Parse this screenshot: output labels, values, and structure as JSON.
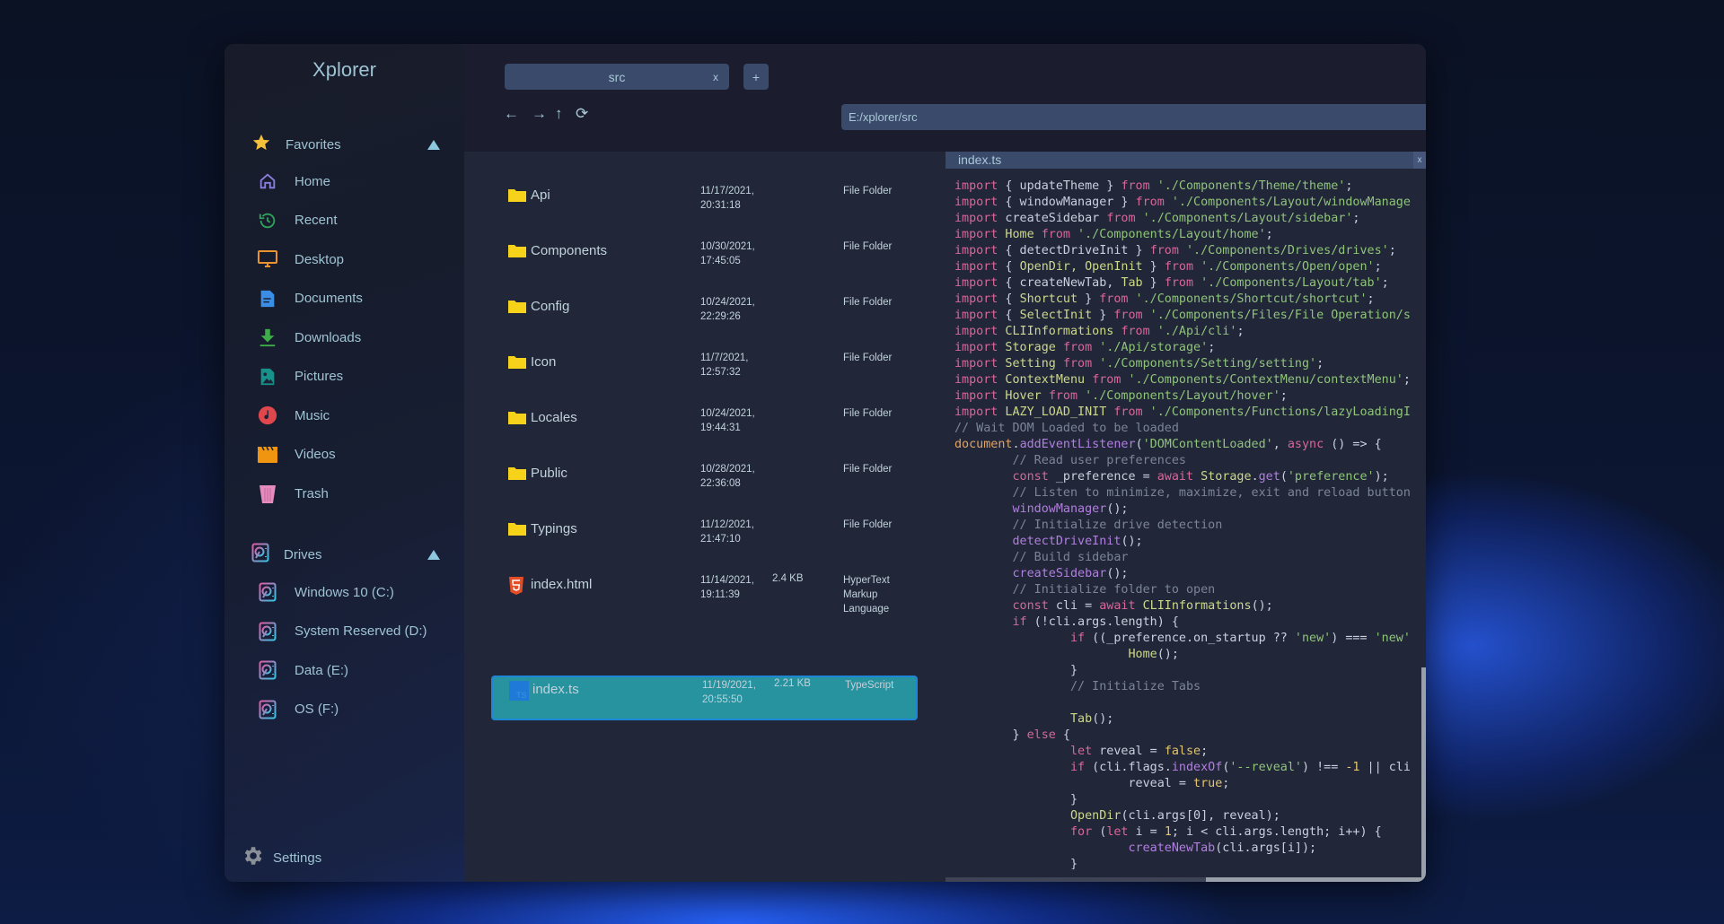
{
  "app": {
    "title": "Xplorer"
  },
  "colors": {
    "accent": "#27939f",
    "traffic": [
      "#ffd60a",
      "#1dbf45",
      "#ff453a"
    ]
  },
  "sidebar": {
    "favorites": {
      "label": "Favorites",
      "icon": "star-icon"
    },
    "items": [
      {
        "label": "Home",
        "icon": "home-icon"
      },
      {
        "label": "Recent",
        "icon": "recent-icon"
      },
      {
        "label": "Desktop",
        "icon": "desktop-icon"
      },
      {
        "label": "Documents",
        "icon": "document-icon"
      },
      {
        "label": "Downloads",
        "icon": "download-icon"
      },
      {
        "label": "Pictures",
        "icon": "picture-icon"
      },
      {
        "label": "Music",
        "icon": "music-icon"
      },
      {
        "label": "Videos",
        "icon": "video-icon"
      },
      {
        "label": "Trash",
        "icon": "trash-icon"
      }
    ],
    "drives_header": {
      "label": "Drives",
      "icon": "drive-icon"
    },
    "drives": [
      {
        "label": "Windows 10 (C:)"
      },
      {
        "label": "System Reserved (D:)"
      },
      {
        "label": "Data (E:)"
      },
      {
        "label": "OS (F:)"
      }
    ],
    "settings": {
      "label": "Settings",
      "icon": "gear-icon"
    }
  },
  "tabs": [
    {
      "label": "src",
      "close": "x"
    }
  ],
  "new_tab": "+",
  "nav": {
    "back": "←",
    "forward": "→",
    "up": "↑",
    "refresh": "⟳"
  },
  "address": {
    "value": "E:/xplorer/src"
  },
  "files": [
    {
      "name": "Api",
      "date": "11/17/2021, 20:31:18",
      "size": "",
      "type": "File Folder",
      "icon": "folder-icon"
    },
    {
      "name": "Components",
      "date": "10/30/2021, 17:45:05",
      "size": "",
      "type": "File Folder",
      "icon": "folder-icon"
    },
    {
      "name": "Config",
      "date": "10/24/2021, 22:29:26",
      "size": "",
      "type": "File Folder",
      "icon": "folder-icon"
    },
    {
      "name": "Icon",
      "date": "11/7/2021, 12:57:32",
      "size": "",
      "type": "File Folder",
      "icon": "folder-icon"
    },
    {
      "name": "Locales",
      "date": "10/24/2021, 19:44:31",
      "size": "",
      "type": "File Folder",
      "icon": "folder-icon"
    },
    {
      "name": "Public",
      "date": "10/28/2021, 22:36:08",
      "size": "",
      "type": "File Folder",
      "icon": "folder-icon"
    },
    {
      "name": "Typings",
      "date": "11/12/2021, 21:47:10",
      "size": "",
      "type": "File Folder",
      "icon": "folder-icon"
    },
    {
      "name": "index.html",
      "date": "11/14/2021, 19:11:39",
      "size": "2.4 KB",
      "type": "HyperText Markup Language",
      "icon": "html5-icon"
    },
    {
      "name": "index.ts",
      "date": "11/19/2021, 20:55:50",
      "size": "2.21 KB",
      "type": "TypeScript",
      "icon": "typescript-icon",
      "selected": true
    }
  ],
  "preview": {
    "title": "index.ts",
    "close": "x",
    "lines": [
      [
        [
          "k",
          "import"
        ],
        [
          "i",
          " { updateTheme } "
        ],
        [
          "k",
          "from"
        ],
        [
          "s",
          " './Components/Theme/theme'"
        ],
        [
          "i",
          ";"
        ]
      ],
      [
        [
          "k",
          "import"
        ],
        [
          "i",
          " { windowManager } "
        ],
        [
          "k",
          "from"
        ],
        [
          "s",
          " './Components/Layout/windowManage"
        ]
      ],
      [
        [
          "k",
          "import"
        ],
        [
          "i",
          " createSidebar "
        ],
        [
          "k",
          "from"
        ],
        [
          "s",
          " './Components/Layout/sidebar'"
        ],
        [
          "i",
          ";"
        ]
      ],
      [
        [
          "k",
          "import"
        ],
        [
          "y",
          " Home "
        ],
        [
          "k",
          "from"
        ],
        [
          "s",
          " './Components/Layout/home'"
        ],
        [
          "i",
          ";"
        ]
      ],
      [
        [
          "k",
          "import"
        ],
        [
          "i",
          " { detectDriveInit } "
        ],
        [
          "k",
          "from"
        ],
        [
          "s",
          " './Components/Drives/drives'"
        ],
        [
          "i",
          ";"
        ]
      ],
      [
        [
          "k",
          "import"
        ],
        [
          "i",
          " { "
        ],
        [
          "y",
          "OpenDir, OpenInit"
        ],
        [
          "i",
          " } "
        ],
        [
          "k",
          "from"
        ],
        [
          "s",
          " './Components/Open/open'"
        ],
        [
          "i",
          ";"
        ]
      ],
      [
        [
          "k",
          "import"
        ],
        [
          "i",
          " { createNewTab, "
        ],
        [
          "y",
          "Tab"
        ],
        [
          "i",
          " } "
        ],
        [
          "k",
          "from"
        ],
        [
          "s",
          " './Components/Layout/tab'"
        ],
        [
          "i",
          ";"
        ]
      ],
      [
        [
          "k",
          "import"
        ],
        [
          "i",
          " { "
        ],
        [
          "y",
          "Shortcut"
        ],
        [
          "i",
          " } "
        ],
        [
          "k",
          "from"
        ],
        [
          "s",
          " './Components/Shortcut/shortcut'"
        ],
        [
          "i",
          ";"
        ]
      ],
      [
        [
          "k",
          "import"
        ],
        [
          "i",
          " { "
        ],
        [
          "y",
          "SelectInit"
        ],
        [
          "i",
          " } "
        ],
        [
          "k",
          "from"
        ],
        [
          "s",
          " './Components/Files/File Operation/s"
        ]
      ],
      [
        [
          "k",
          "import"
        ],
        [
          "y",
          " CLIInformations "
        ],
        [
          "k",
          "from"
        ],
        [
          "s",
          " './Api/cli'"
        ],
        [
          "i",
          ";"
        ]
      ],
      [
        [
          "k",
          "import"
        ],
        [
          "y",
          " Storage "
        ],
        [
          "k",
          "from"
        ],
        [
          "s",
          " './Api/storage'"
        ],
        [
          "i",
          ";"
        ]
      ],
      [
        [
          "k",
          "import"
        ],
        [
          "y",
          " Setting "
        ],
        [
          "k",
          "from"
        ],
        [
          "s",
          " './Components/Setting/setting'"
        ],
        [
          "i",
          ";"
        ]
      ],
      [
        [
          "k",
          "import"
        ],
        [
          "y",
          " ContextMenu "
        ],
        [
          "k",
          "from"
        ],
        [
          "s",
          " './Components/ContextMenu/contextMenu'"
        ],
        [
          "i",
          ";"
        ]
      ],
      [
        [
          "k",
          "import"
        ],
        [
          "y",
          " Hover "
        ],
        [
          "k",
          "from"
        ],
        [
          "s",
          " './Components/Layout/hover'"
        ],
        [
          "i",
          ";"
        ]
      ],
      [
        [
          "k",
          "import"
        ],
        [
          "y",
          " LAZY_LOAD_INIT "
        ],
        [
          "k",
          "from"
        ],
        [
          "s",
          " './Components/Functions/lazyLoadingI"
        ]
      ],
      [
        [
          "c",
          "// Wait DOM Loaded to be loaded"
        ]
      ],
      [
        [
          "o",
          "document"
        ],
        [
          "i",
          "."
        ],
        [
          "f",
          "addEventListener"
        ],
        [
          "i",
          "("
        ],
        [
          "s",
          "'DOMContentLoaded'"
        ],
        [
          "i",
          ", "
        ],
        [
          "k",
          "async"
        ],
        [
          "i",
          " () => {"
        ]
      ],
      [
        [
          "c",
          "        // Read user preferences"
        ]
      ],
      [
        [
          "k",
          "        const"
        ],
        [
          "i",
          " _preference = "
        ],
        [
          "k",
          "await"
        ],
        [
          "y",
          " Storage"
        ],
        [
          "i",
          "."
        ],
        [
          "f",
          "get"
        ],
        [
          "i",
          "("
        ],
        [
          "s",
          "'preference'"
        ],
        [
          "i",
          ");"
        ]
      ],
      [
        [
          "c",
          "        // Listen to minimize, maximize, exit and reload button"
        ]
      ],
      [
        [
          "f",
          "        windowManager"
        ],
        [
          "i",
          "();"
        ]
      ],
      [
        [
          "c",
          "        // Initialize drive detection"
        ]
      ],
      [
        [
          "f",
          "        detectDriveInit"
        ],
        [
          "i",
          "();"
        ]
      ],
      [
        [
          "c",
          "        // Build sidebar"
        ]
      ],
      [
        [
          "f",
          "        createSidebar"
        ],
        [
          "i",
          "();"
        ]
      ],
      [
        [
          "c",
          "        // Initialize folder to open"
        ]
      ],
      [
        [
          "k",
          "        const"
        ],
        [
          "i",
          " cli = "
        ],
        [
          "k",
          "await"
        ],
        [
          "y",
          " CLIInformations"
        ],
        [
          "i",
          "();"
        ]
      ],
      [
        [
          "k",
          "        if"
        ],
        [
          "i",
          " (!cli.args.length) {"
        ]
      ],
      [
        [
          "k",
          "                if"
        ],
        [
          "i",
          " ((_preference.on_startup ?? "
        ],
        [
          "s",
          "'new'"
        ],
        [
          "i",
          ") === "
        ],
        [
          "s",
          "'new'"
        ]
      ],
      [
        [
          "y",
          "                        Home"
        ],
        [
          "i",
          "();"
        ]
      ],
      [
        [
          "i",
          "                }"
        ]
      ],
      [
        [
          "c",
          "                // Initialize Tabs"
        ]
      ],
      [
        [
          "i",
          " "
        ]
      ],
      [
        [
          "y",
          "                Tab"
        ],
        [
          "i",
          "();"
        ]
      ],
      [
        [
          "i",
          "        } "
        ],
        [
          "k",
          "else"
        ],
        [
          "i",
          " {"
        ]
      ],
      [
        [
          "k",
          "                let"
        ],
        [
          "i",
          " reveal = "
        ],
        [
          "n",
          "false"
        ],
        [
          "i",
          ";"
        ]
      ],
      [
        [
          "k",
          "                if"
        ],
        [
          "i",
          " (cli.flags."
        ],
        [
          "f",
          "indexOf"
        ],
        [
          "i",
          "("
        ],
        [
          "s",
          "'--reveal'"
        ],
        [
          "i",
          ") !== "
        ],
        [
          "n",
          "-1"
        ],
        [
          "i",
          " || cli"
        ]
      ],
      [
        [
          "i",
          "                        reveal = "
        ],
        [
          "n",
          "true"
        ],
        [
          "i",
          ";"
        ]
      ],
      [
        [
          "i",
          "                }"
        ]
      ],
      [
        [
          "y",
          "                OpenDir"
        ],
        [
          "i",
          "(cli.args[0], reveal);"
        ]
      ],
      [
        [
          "k",
          "                for"
        ],
        [
          "i",
          " ("
        ],
        [
          "k",
          "let"
        ],
        [
          "i",
          " i = "
        ],
        [
          "n",
          "1"
        ],
        [
          "i",
          "; i < cli.args.length; i++) {"
        ]
      ],
      [
        [
          "f",
          "                        createNewTab"
        ],
        [
          "i",
          "(cli.args[i]);"
        ]
      ],
      [
        [
          "i",
          "                }"
        ]
      ]
    ]
  }
}
